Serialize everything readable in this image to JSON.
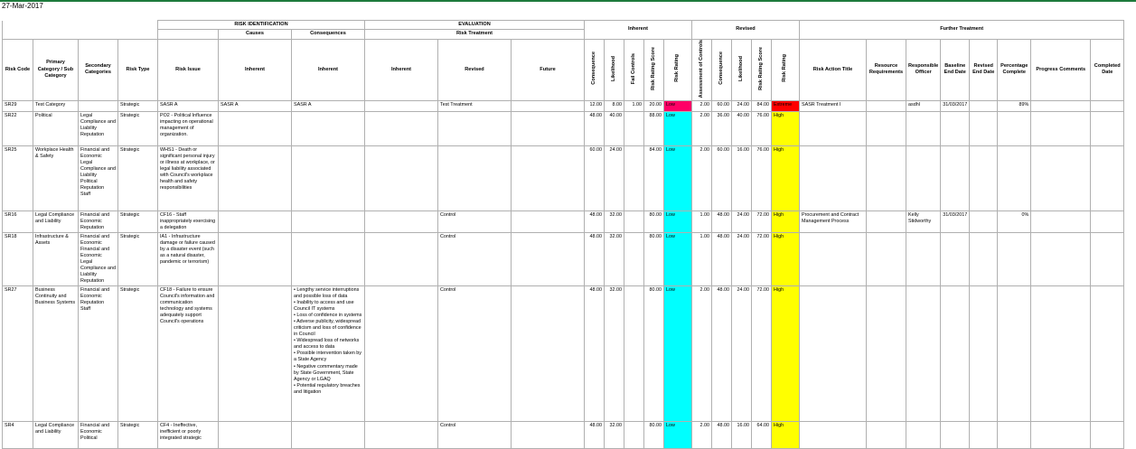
{
  "report_date": "27-Mar-2017",
  "headers": {
    "risk_identification": "RISK IDENTIFICATION",
    "causes": "Causes",
    "consequences": "Consequences",
    "evaluation": "EVALUATION",
    "risk_treatment": "Risk Treatment",
    "inherent_group": "Inherent",
    "revised_group": "Revised",
    "further_treatment": "Further Treatment",
    "risk_code": "Risk Code",
    "primary_category": "Primary Category / Sub Category",
    "secondary_categories": "Secondary Categories",
    "risk_type": "Risk Type",
    "risk_issue": "Risk Issue",
    "causes_inherent": "Inherent",
    "consequences_inherent": "Inherent",
    "eval_inherent": "Inherent",
    "eval_revised": "Revised",
    "eval_future": "Future",
    "inh_consequence": "Consequence",
    "inh_likelihood": "Likelihood",
    "inh_fail_controls": "Fail Controls",
    "inh_risk_score": "Risk Rating Score",
    "inh_risk_rating": "Risk Rating",
    "rev_assessment": "Assessment of Controls",
    "rev_consequence": "Consequence",
    "rev_likelihood": "Likelihood",
    "rev_risk_score": "Risk Rating Score",
    "rev_risk_rating": "Risk Rating",
    "action_title": "Risk Action Title",
    "resource_requirements": "Resource Requirements",
    "responsible_officer": "Responsible Officer",
    "baseline_end_date": "Baseline End Date",
    "revised_end_date": "Revised End Date",
    "percentage_complete": "Percentage Complete",
    "progress_comments": "Progress Comments",
    "completed_date": "Completed Date"
  },
  "rows": [
    {
      "code": "SR29",
      "primary": [
        "Test Category"
      ],
      "secondary": [],
      "type": "Strategic",
      "issue": "SASR A",
      "causes": "SASR A",
      "consequences": [],
      "consequences_text": "SASR A",
      "eval_inherent": "",
      "eval_revised": "Test Treatment",
      "eval_future": "",
      "inh_cons": "12.00",
      "inh_like": "8.00",
      "inh_fail": "1.00",
      "inh_score": "20.00",
      "inh_rating": "Low",
      "inh_color": "pink",
      "rev_assess": "2.00",
      "rev_cons": "60.00",
      "rev_like": "24.00",
      "rev_score": "84.00",
      "rev_rating": "Extreme",
      "rev_color": "red",
      "action_title": "SASR Treatment I",
      "resource": "",
      "officer": "asdhl",
      "baseline": "31/03/2017",
      "revised_end": "",
      "percent": "89%",
      "comments": "",
      "completed": ""
    },
    {
      "code": "SR22",
      "primary": [
        "Political"
      ],
      "secondary": [
        "Legal Compliance and Liability",
        "Reputation"
      ],
      "type": "Strategic",
      "issue": "PO2 - Political Influence impacting on operational management of organization.",
      "causes": "",
      "consequences": [],
      "consequences_text": "",
      "eval_inherent": "",
      "eval_revised": "",
      "eval_future": "",
      "inh_cons": "48.00",
      "inh_like": "40.00",
      "inh_fail": "",
      "inh_score": "88.00",
      "inh_rating": "Low",
      "inh_color": "cyan",
      "rev_assess": "2.00",
      "rev_cons": "36.00",
      "rev_like": "40.00",
      "rev_score": "76.00",
      "rev_rating": "High",
      "rev_color": "yellow",
      "action_title": "",
      "resource": "",
      "officer": "",
      "baseline": "",
      "revised_end": "",
      "percent": "",
      "comments": "",
      "completed": ""
    },
    {
      "code": "SR25",
      "primary": [
        "Workplace Health & Safety"
      ],
      "secondary": [
        "Financial and Economic",
        "Legal Compliance and Liability",
        "Political",
        "Reputation",
        "Staff"
      ],
      "type": "Strategic",
      "issue": "WHS1 - Death or significant personal injury or illness at workplace, or legal liability associated with Council's workplace health and safety responsibilities",
      "causes": "",
      "consequences": [],
      "consequences_text": "",
      "eval_inherent": "",
      "eval_revised": "",
      "eval_future": "",
      "inh_cons": "60.00",
      "inh_like": "24.00",
      "inh_fail": "",
      "inh_score": "84.00",
      "inh_rating": "Low",
      "inh_color": "cyan",
      "rev_assess": "2.00",
      "rev_cons": "60.00",
      "rev_like": "16.00",
      "rev_score": "76.00",
      "rev_rating": "High",
      "rev_color": "yellow",
      "action_title": "",
      "resource": "",
      "officer": "",
      "baseline": "",
      "revised_end": "",
      "percent": "",
      "comments": "",
      "completed": ""
    },
    {
      "code": "SR16",
      "primary": [
        "Legal Compliance and Liability"
      ],
      "secondary": [
        "Financial and Economic",
        "Reputation"
      ],
      "type": "Strategic",
      "issue": "CF16 - Staff inappropriately exercising a delegation",
      "causes": "",
      "consequences": [],
      "consequences_text": "",
      "eval_inherent": "",
      "eval_revised": "Control",
      "eval_future": "",
      "inh_cons": "48.00",
      "inh_like": "32.00",
      "inh_fail": "",
      "inh_score": "80.00",
      "inh_rating": "Low",
      "inh_color": "cyan",
      "rev_assess": "1.00",
      "rev_cons": "48.00",
      "rev_like": "24.00",
      "rev_score": "72.00",
      "rev_rating": "High",
      "rev_color": "yellow",
      "action_title": "Procurement and Contract Management Process",
      "resource": "",
      "officer": "Kelly Stidworthy",
      "baseline": "31/03/2017",
      "revised_end": "",
      "percent": "0%",
      "comments": "",
      "completed": ""
    },
    {
      "code": "SR18",
      "primary": [
        "Infrastructure & Assets"
      ],
      "secondary": [
        "Financial and Economic",
        "Financial and Economic",
        "Legal Compliance and Liability",
        "Reputation"
      ],
      "type": "Strategic",
      "issue": "IA1 - Infrastructure damage or failure caused by a disaster event (such as a natural disaster, pandemic or terrorism)",
      "causes": "",
      "consequences": [],
      "consequences_text": "",
      "eval_inherent": "",
      "eval_revised": "Control",
      "eval_future": "",
      "inh_cons": "48.00",
      "inh_like": "32.00",
      "inh_fail": "",
      "inh_score": "80.00",
      "inh_rating": "Low",
      "inh_color": "cyan",
      "rev_assess": "1.00",
      "rev_cons": "48.00",
      "rev_like": "24.00",
      "rev_score": "72.00",
      "rev_rating": "High",
      "rev_color": "yellow",
      "action_title": "",
      "resource": "",
      "officer": "",
      "baseline": "",
      "revised_end": "",
      "percent": "",
      "comments": "",
      "completed": ""
    },
    {
      "code": "SR27",
      "primary": [
        "Business Continuity and Business Systems"
      ],
      "secondary": [
        "Financial and Economic",
        "Reputation",
        "Staff"
      ],
      "type": "Strategic",
      "issue": "CF18 - Failure to ensure Council's information and communication technology and systems adequately support Council's operations",
      "causes": "",
      "consequences": [
        "• Lengthy service interruptions and possible loss of data",
        "• Inability to access and use Council IT systems",
        "• Loss of confidence in systems",
        "• Adverse publicity, widespread criticism and loss of confidence in Council",
        "• Widespread loss of networks and access to data",
        "• Possible intervention taken by a State Agency",
        "• Negative commentary made by State Government, State Agency or LGAQ",
        "• Potential regulatory breaches and litigation"
      ],
      "consequences_text": "",
      "eval_inherent": "",
      "eval_revised": "Control",
      "eval_future": "",
      "inh_cons": "48.00",
      "inh_like": "32.00",
      "inh_fail": "",
      "inh_score": "80.00",
      "inh_rating": "Low",
      "inh_color": "cyan",
      "rev_assess": "2.00",
      "rev_cons": "48.00",
      "rev_like": "24.00",
      "rev_score": "72.00",
      "rev_rating": "High",
      "rev_color": "yellow",
      "action_title": "",
      "resource": "",
      "officer": "",
      "baseline": "",
      "revised_end": "",
      "percent": "",
      "comments": "",
      "completed": ""
    },
    {
      "code": "SR4",
      "primary": [
        "Legal Compliance and Liability"
      ],
      "secondary": [
        "Financial and Economic",
        "Political"
      ],
      "type": "Strategic",
      "issue": "CF4 - Ineffective, inefficient or poorly integrated strategic",
      "causes": "",
      "consequences": [],
      "consequences_text": "",
      "eval_inherent": "",
      "eval_revised": "Control",
      "eval_future": "",
      "inh_cons": "48.00",
      "inh_like": "32.00",
      "inh_fail": "",
      "inh_score": "80.00",
      "inh_rating": "Low",
      "inh_color": "cyan",
      "rev_assess": "2.00",
      "rev_cons": "48.00",
      "rev_like": "16.00",
      "rev_score": "64.00",
      "rev_rating": "High",
      "rev_color": "yellow",
      "action_title": "",
      "resource": "",
      "officer": "",
      "baseline": "",
      "revised_end": "",
      "percent": "",
      "comments": "",
      "completed": ""
    }
  ]
}
